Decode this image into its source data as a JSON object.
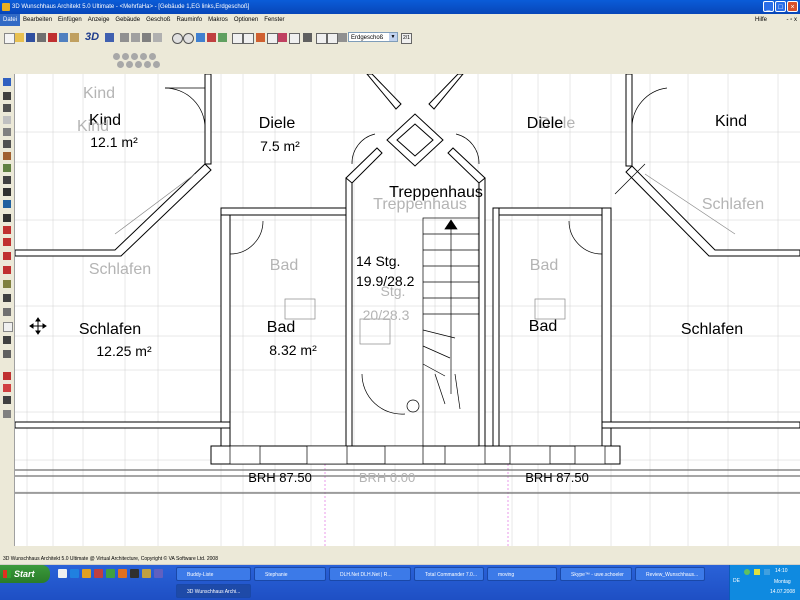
{
  "window": {
    "title": "3D Wunschhaus Architekt 5.0 Ultimate - <MehrfaHa> - [Gebäude 1,EG links,Erdgeschoß]"
  },
  "menu": {
    "items": [
      "Datei",
      "Bearbeiten",
      "Einfügen",
      "Anzeige",
      "Gebäude",
      "Geschoß",
      "Rauminfo",
      "Makros",
      "Optionen",
      "Fenster"
    ],
    "help": "Hilfe",
    "window_controls": "- ▫ x"
  },
  "toolbar": {
    "view_3d_label": "3D",
    "floor_select": "Erdgeschoß",
    "floor_button": "2/1"
  },
  "rooms": {
    "kind_left_ghost": "Kind",
    "kind_left": "Kind",
    "kind_left_ghost2": "Kind",
    "kind_left_area": "12.1 m²",
    "diele_left": "Diele",
    "diele_left_area": "7.5 m²",
    "treppenhaus": "Treppenhaus",
    "treppenhaus_ghost": "Treppenhaus",
    "diele_right": "Diele",
    "diele_right_ghost": "Diele",
    "kind_right": "Kind",
    "schlafen_right_ghost": "Schlafen",
    "schlafen_left_ghost": "Schlafen",
    "bad_left_ghost": "Bad",
    "bad_left": "Bad",
    "bad_left_area": "8.32 m²",
    "schlafen_left": "Schlafen",
    "schlafen_left_area": "12.25 m²",
    "stairs_count": "14 Stg.",
    "stairs_dim": "19.9/28.2",
    "stairs_ghost": "Stg.",
    "stairs_ghost_dim": "20/28.3",
    "bad_right_ghost": "Bad",
    "bad_right": "Bad",
    "schlafen_right": "Schlafen",
    "brh_left": "BRH 87.50",
    "brh_center": "BRH 0.00",
    "brh_right": "BRH 87.50"
  },
  "status": {
    "copyright": "3D Wunschhaus Architekt 5.0 Ultimate @ Virtual Architecture, Copyright © VA Software Ltd. 2008"
  },
  "taskbar": {
    "start": "Start",
    "tasks": [
      "Buddy-Liste",
      "Stephanie",
      "DLH.Net DLH.Net | R...",
      "Total Commander 7.0...",
      "moving",
      "Skype™ - uwe.schoeler",
      "Review_Wunschhaus...",
      "3D Wunschhaus Archi..."
    ],
    "lang": "DE",
    "time": "14:10",
    "day": "Montag",
    "date": "14.07.2008"
  },
  "colors": {
    "title_bar": "#0a5cd8",
    "wall_fill": "#ffffff",
    "wall_line": "#000000",
    "ghost_text": "#b4b4b4",
    "taskbar": "#2a62d8",
    "start_button": "#3c9a3c"
  }
}
